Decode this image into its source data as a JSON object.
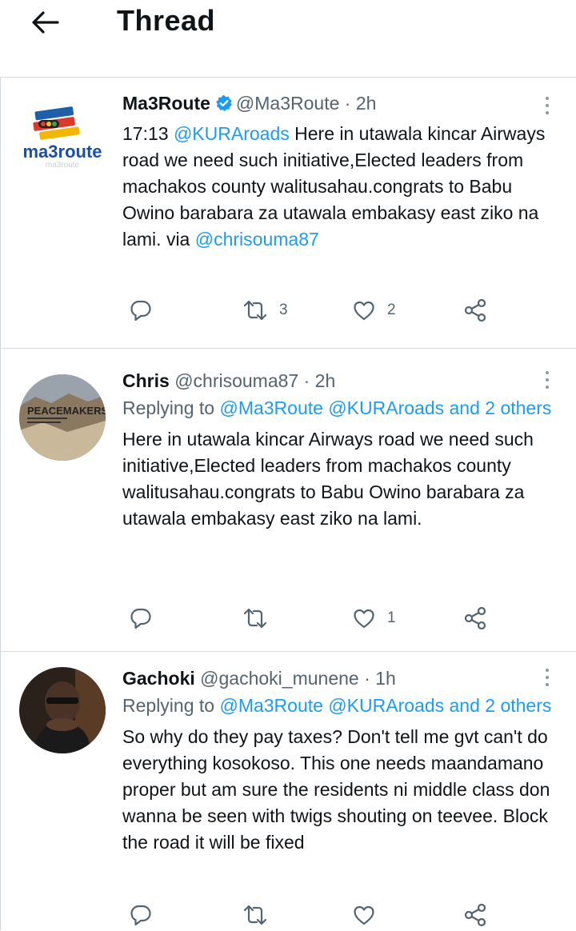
{
  "header": {
    "title": "Thread",
    "back_icon": "arrow-left-icon"
  },
  "colors": {
    "link": "#1d9bf0",
    "verified": "#1d9bf0",
    "muted": "#536471"
  },
  "tweets": [
    {
      "name": "Ma3Route",
      "verified": true,
      "handle": "@Ma3Route",
      "dot": "·",
      "time": "2h",
      "avatar_text": "ma3route",
      "text_prefix": "17:13 ",
      "mention": "@KURAroads",
      "text_main": " Here in utawala kincar Airways road we need such initiative,Elected leaders from machakos county walitusahau.congrats to Babu Owino barabara za utawala embakasy east ziko na lami. via ",
      "via": "@chrisouma87",
      "retweets": "3",
      "likes": "2"
    },
    {
      "name": "Chris",
      "handle": "@chrisouma87",
      "dot": "·",
      "time": "2h",
      "avatar_text": "PEACEMAKERS",
      "replying_label": "Replying to ",
      "replying_to": "@Ma3Route @KURAroads and 2 others",
      "text": "Here in utawala kincar Airways road we need such initiative,Elected leaders from machakos county walitusahau.congrats to Babu Owino barabara za utawala embakasy east ziko na lami.",
      "retweets": "",
      "likes": "1"
    },
    {
      "name": "Gachoki",
      "handle": "@gachoki_munene",
      "dot": "·",
      "time": "1h",
      "replying_label": "Replying to ",
      "replying_to": "@Ma3Route @KURAroads and 2 others",
      "text": "So why do they pay taxes? Don't tell me gvt can't do everything kosokoso. This one needs maandamano proper but am sure the residents ni middle class don wanna be seen with twigs shouting on teevee. Block the road it will be fixed",
      "retweets": "",
      "likes": ""
    }
  ]
}
